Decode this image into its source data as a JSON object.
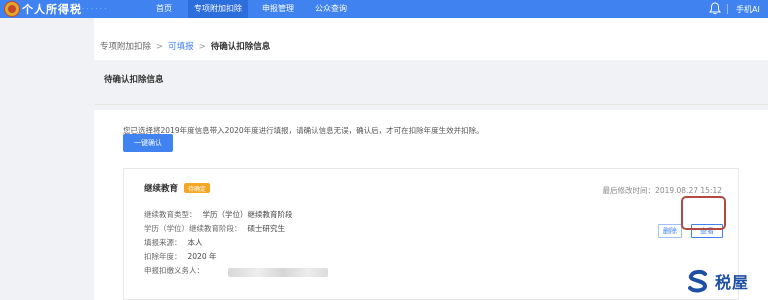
{
  "app": {
    "title": "个人所得税",
    "subtitle": "· · · · · ·"
  },
  "nav": [
    {
      "label": "首页",
      "active": false
    },
    {
      "label": "专项附加扣除",
      "active": true
    },
    {
      "label": "申报管理",
      "active": false
    },
    {
      "label": "公众查询",
      "active": false
    }
  ],
  "header_right": {
    "phone_label": "手机AI"
  },
  "breadcrumb": {
    "items": [
      "专项附加扣除",
      "可填报",
      "待确认扣除信息"
    ],
    "separator": ">"
  },
  "section": {
    "title": "待确认扣除信息"
  },
  "notice": "您已选择将2019年度信息带入2020年度进行填报，请确认信息无误，确认后，才可在扣除年度生效并扣除。",
  "confirm_all_button": "一键确认",
  "card": {
    "title": "继续教育",
    "tag": "待确定",
    "modified_label": "最后修改时间：",
    "modified_value": "2019.08.27 15:12",
    "fields": [
      {
        "label": "继续教育类型：",
        "value": "学历（学位）继续教育阶段"
      },
      {
        "label": "学历（学位）继续教育阶段：",
        "value": "硕士研究生"
      },
      {
        "label": "填报来源：",
        "value": "本人"
      },
      {
        "label": "扣除年度：",
        "value": "2020 年"
      },
      {
        "label": "申报扣缴义务人：",
        "value": ""
      }
    ],
    "delete_button": "删除",
    "view_button": "查看"
  },
  "watermark": {
    "text": "税屋"
  },
  "colors": {
    "primary": "#3f82f0",
    "tag": "#f5a623",
    "highlight": "#b14a40",
    "watermark": "#1d4fa3"
  },
  "icons": {
    "notification": "bell-icon",
    "emblem": "tax-emblem-icon",
    "watermark_logo": "s-logo-icon"
  }
}
